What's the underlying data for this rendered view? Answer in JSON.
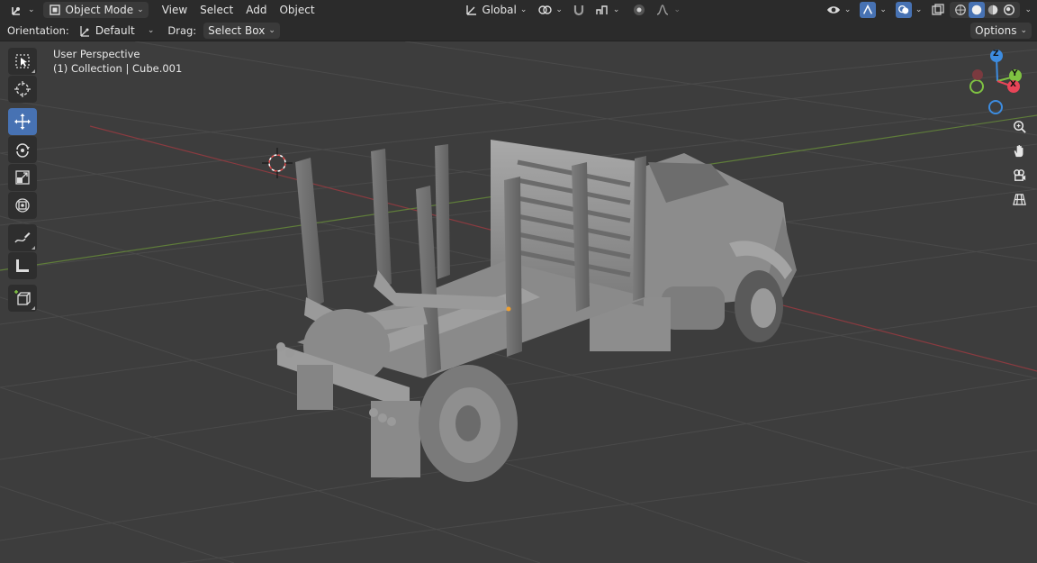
{
  "header": {
    "editor_type_icon": "axes-editor-icon",
    "mode_label": "Object Mode",
    "menus": [
      "View",
      "Select",
      "Add",
      "Object"
    ],
    "transform_orientation": "Global"
  },
  "tool_settings": {
    "orientation_label": "Orientation:",
    "orientation_value": "Default",
    "drag_label": "Drag:",
    "drag_value": "Select Box",
    "options_label": "Options"
  },
  "viewport": {
    "view_name": "User Perspective",
    "collection_info": "(1) Collection | Cube.001"
  },
  "gizmo": {
    "z": "Z",
    "y": "Y",
    "x": "X"
  },
  "colors": {
    "header_bg": "#2b2b2b",
    "viewport_bg": "#3d3d3d",
    "active_tool": "#4772b3",
    "axis_x": "#e84558",
    "axis_y": "#7fc242",
    "axis_z": "#3d8ce0"
  }
}
